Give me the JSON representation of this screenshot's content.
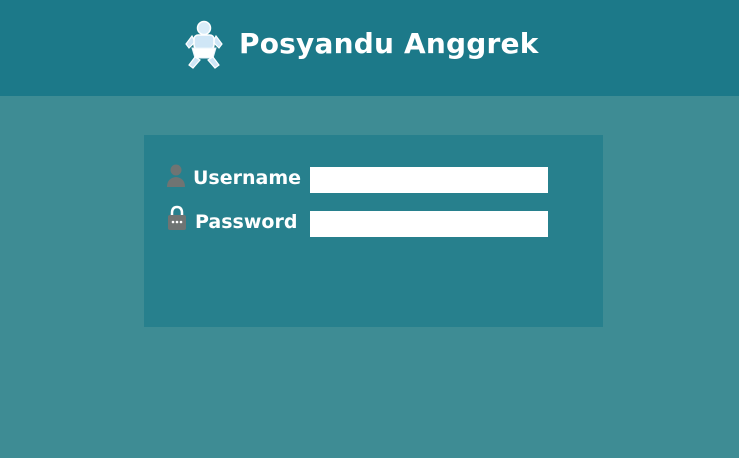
{
  "header": {
    "title": "Posyandu Anggrek",
    "logo_icon": "baby-diaper-icon"
  },
  "login": {
    "username": {
      "icon": "user-icon",
      "label": "Username",
      "value": ""
    },
    "password": {
      "icon": "lock-icon",
      "label": "Password",
      "value": ""
    }
  },
  "colors": {
    "page_background": "#3e8c94",
    "header_background": "#1c7989",
    "panel_background": "#27808d",
    "icon_gray": "#6f7473"
  }
}
